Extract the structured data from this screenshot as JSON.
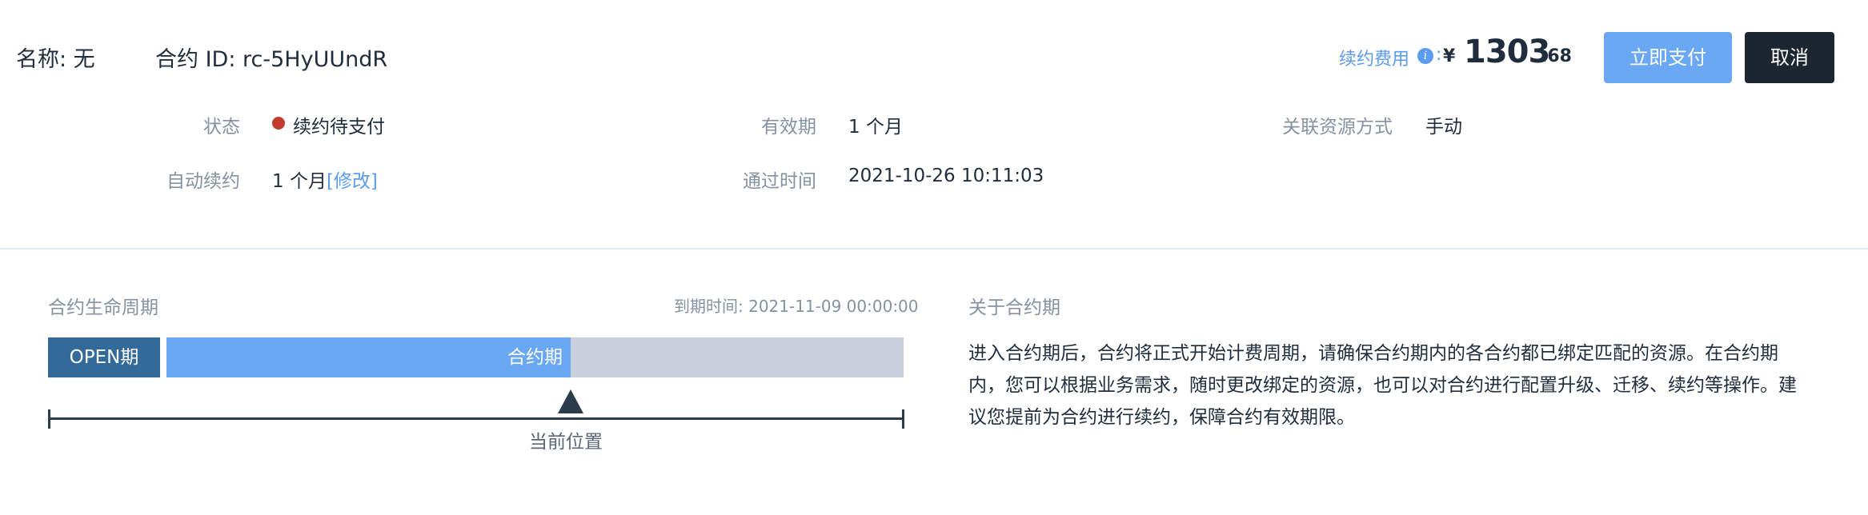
{
  "header": {
    "name_text": "名称: 无",
    "contract_id_text": "合约 ID: rc-5HyUUndR",
    "fee_label": "续约费用",
    "fee_colon": ":",
    "info_icon": "i",
    "currency": "¥",
    "amount_integer": "1303",
    "amount_decimal": ".68",
    "pay_button": "立即支付",
    "cancel_button": "取消"
  },
  "info": {
    "status_label": "状态",
    "status_value": "续约待支付",
    "status_color": "#c23b2e",
    "validity_label": "有效期",
    "validity_value": "1 个月",
    "binding_label": "关联资源方式",
    "binding_value": "手动",
    "auto_renew_label": "自动续约",
    "auto_renew_value": "1 个月",
    "auto_renew_link": "[修改]",
    "approved_label": "通过时间",
    "approved_value": "2021-10-26 10:11:03"
  },
  "lifecycle": {
    "title": "合约生命周期",
    "due_text": "到期时间: 2021-11-09 00:00:00",
    "open_segment": "OPEN期",
    "contract_segment": "合约期",
    "current_position": "当前位置"
  },
  "about": {
    "title": "关于合约期",
    "text": "进入合约期后，合约将正式开始计费周期，请确保合约期内的各合约都已绑定匹配的资源。在合约期内，您可以根据业务需求，随时更改绑定的资源，也可以对合约进行配置升级、迁移、续约等操作。建议您提前为合约进行续约，保障合约有效期限。"
  },
  "colors": {
    "accent": "#5b9bf0",
    "open_segment": "#336a99",
    "contract_segment": "#6aa8f4",
    "remaining_segment": "#c8d1db",
    "cancel_button": "#1c2631"
  }
}
